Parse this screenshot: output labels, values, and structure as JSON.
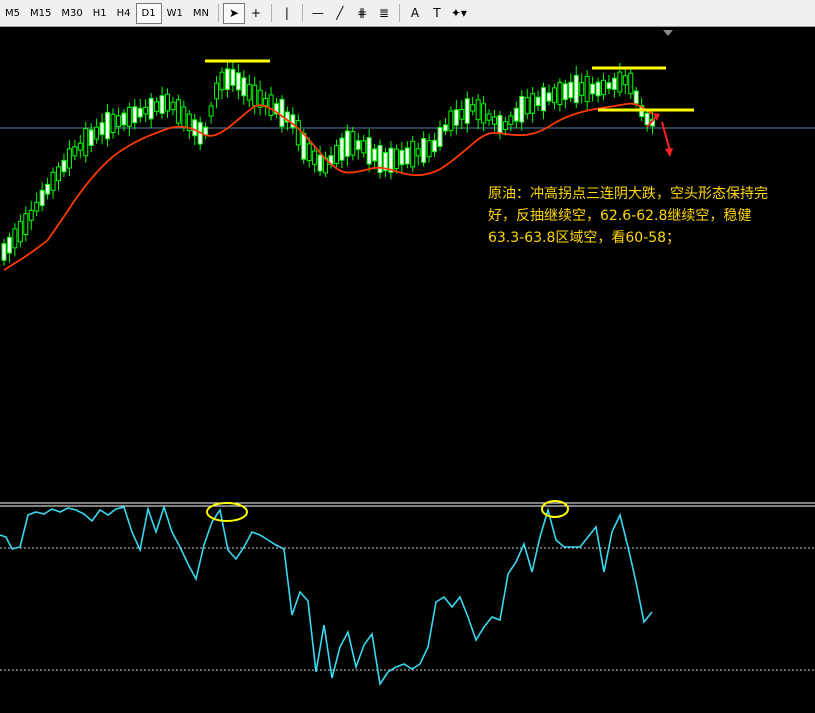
{
  "toolbar": {
    "timeframes": [
      "M5",
      "M15",
      "M30",
      "H1",
      "H4",
      "D1",
      "W1",
      "MN"
    ],
    "active_timeframe": "D1",
    "tools": [
      {
        "name": "cursor-icon",
        "glyph": "➤"
      },
      {
        "name": "crosshair-icon",
        "glyph": "+"
      },
      {
        "name": "vertical-line-icon",
        "glyph": "|"
      },
      {
        "name": "horizontal-line-icon",
        "glyph": "—"
      },
      {
        "name": "trendline-icon",
        "glyph": "╱"
      },
      {
        "name": "equidistant-channel-icon",
        "glyph": "⋕"
      },
      {
        "name": "fibonacci-icon",
        "glyph": "≣"
      },
      {
        "name": "text-icon",
        "glyph": "A"
      },
      {
        "name": "text-label-icon",
        "glyph": "T"
      },
      {
        "name": "shapes-dropdown-icon",
        "glyph": "✦▾"
      }
    ]
  },
  "annotation": {
    "line1": "原油：冲高拐点三连阴大跌，空头形态保持完",
    "line2": "好，反抽继续空，62.6-62.8继续空，稳健",
    "line3": "63.3-63.8区域空，看60-58；"
  },
  "colors": {
    "bull": "#00ff00",
    "bull_fill": "#ffffff",
    "bear": "#00ff00",
    "ma": "#ff3a00",
    "oscillator": "#38d8f0",
    "marker": "#ffff00",
    "arrow": "#ff2020"
  }
}
